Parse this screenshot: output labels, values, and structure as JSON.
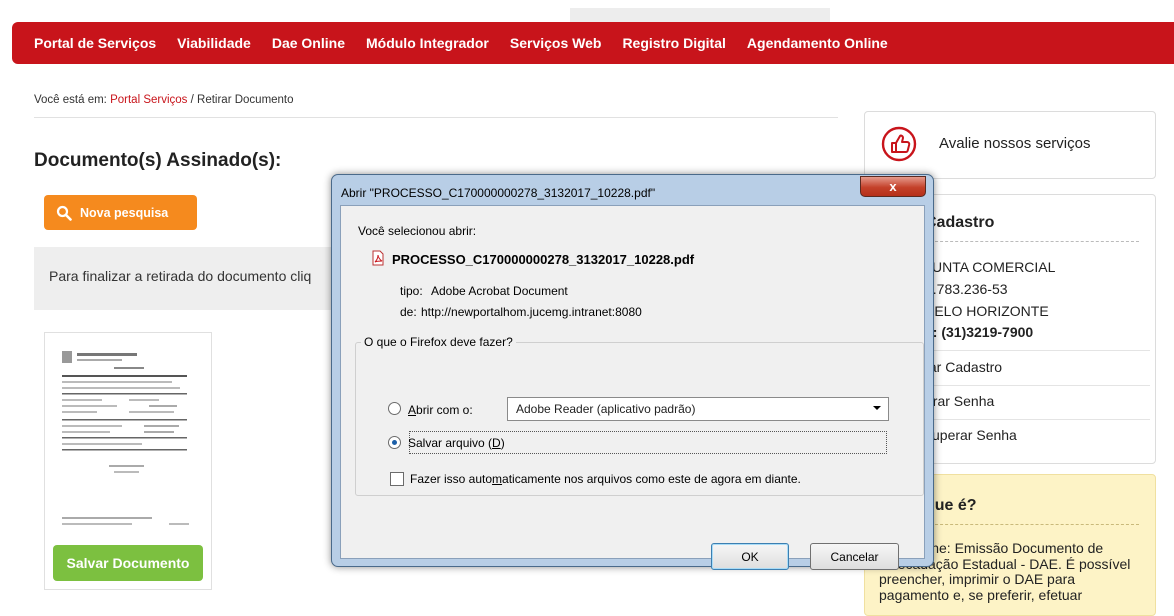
{
  "nav": {
    "items": [
      "Portal de Serviços",
      "Viabilidade",
      "Dae Online",
      "Módulo Integrador",
      "Serviços Web",
      "Registro Digital",
      "Agendamento Online"
    ]
  },
  "breadcrumb": {
    "prefix": "Você está em: ",
    "link": "Portal Serviços",
    "sep": " / ",
    "current": "Retirar Documento"
  },
  "main": {
    "title": "Documento(s) Assinado(s):",
    "search_button": "Nova pesquisa",
    "info_text": "Para finalizar a retirada do documento cliq",
    "save_button": "Salvar Documento"
  },
  "sidebar": {
    "avalie": "Avalie nossos serviços",
    "cadastro_title": "Cadastro",
    "cadastro_lines": [
      "JUNTA COMERCIAL",
      "8.783.236-53",
      "BELO HORIZONTE",
      "e: (31)3219-7900"
    ],
    "cadastro_links": [
      "tar Cadastro",
      "erar Senha",
      "cuperar Senha"
    ],
    "oque_title": "que é?",
    "oque_bold": "line:",
    "oque_text": " Emissão Documento de Arrecadação Estadual - DAE. É possível preencher, imprimir o DAE para pagamento e, se preferir, efetuar"
  },
  "dialog": {
    "title": "Abrir \"PROCESSO_C170000000278_3132017_10228.pdf\"",
    "close": "x",
    "selected_label": "Você selecionou abrir:",
    "file_name": "PROCESSO_C170000000278_3132017_10228.pdf",
    "type_key": "tipo:",
    "type_value": "Adobe Acrobat Document",
    "from_key": "de:",
    "from_value": "http://newportalhom.jucemg.intranet:8080",
    "group_title": "O que o Firefox deve fazer?",
    "open_with_pre": "",
    "open_with_u": "A",
    "open_with_post": "brir com o:",
    "open_with_value": "Adobe Reader  (aplicativo padrão)",
    "save_pre": "Salvar arquivo (",
    "save_u": "D",
    "save_post": ")",
    "auto_pre": "Fazer isso auto",
    "auto_u": "m",
    "auto_post": "aticamente nos arquivos como este de agora em diante.",
    "ok": "OK",
    "cancel": "Cancelar"
  },
  "colors": {
    "nav_red": "#c8141b",
    "orange": "#f58a1e",
    "green": "#7cc040",
    "info_yellow": "#fdf3c6"
  }
}
